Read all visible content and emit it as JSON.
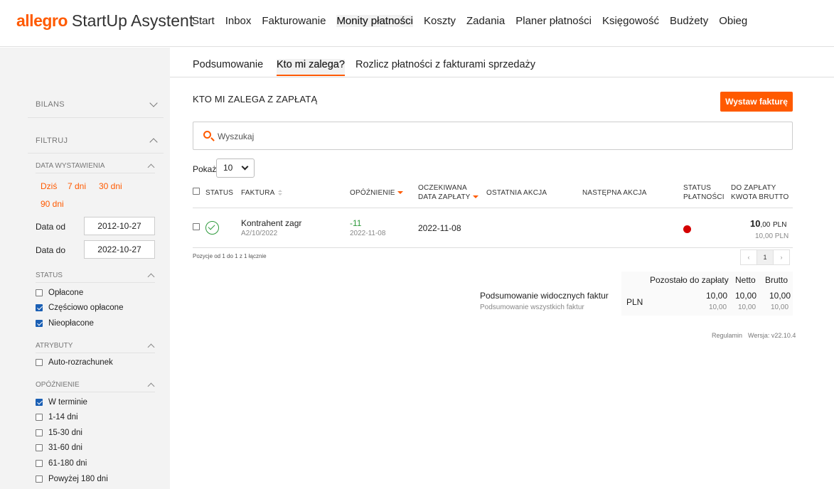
{
  "header": {
    "brand": "allegro",
    "app_name": "StartUp Asystent",
    "nav": [
      "Start",
      "Inbox",
      "Fakturowanie",
      "Monity płatności",
      "Koszty",
      "Zadania",
      "Planer płatności",
      "Księgowość",
      "Budżety",
      "Obieg"
    ],
    "active_nav": "Monity płatności"
  },
  "sidebar": {
    "bilans": "BILANS",
    "filtruj": "FILTRUJ",
    "date_section": "DATA WYSTAWIENIA",
    "quick_ranges": [
      "Dziś",
      "7 dni",
      "30 dni",
      "90 dni"
    ],
    "date_from_label": "Data od",
    "date_from": "2012-10-27",
    "date_to_label": "Data do",
    "date_to": "2022-10-27",
    "status_section": "STATUS",
    "status_items": [
      {
        "label": "Opłacone",
        "checked": false
      },
      {
        "label": "Częściowo opłacone",
        "checked": true
      },
      {
        "label": "Nieopłacone",
        "checked": true
      }
    ],
    "attr_section": "ATRYBUTY",
    "attr_items": [
      {
        "label": "Auto-rozrachunek",
        "checked": false
      }
    ],
    "delay_section": "OPÓŹNIENIE",
    "delay_items": [
      {
        "label": "W terminie",
        "checked": true
      },
      {
        "label": "1-14 dni",
        "checked": false
      },
      {
        "label": "15-30 dni",
        "checked": false
      },
      {
        "label": "31-60 dni",
        "checked": false
      },
      {
        "label": "61-180 dni",
        "checked": false
      },
      {
        "label": "Powyżej 180 dni",
        "checked": false
      }
    ]
  },
  "tabs": [
    "Podsumowanie",
    "Kto mi zalega?",
    "Rozlicz płatności z fakturami sprzedaży"
  ],
  "main": {
    "title": "KTO MI ZALEGA Z ZAPŁATĄ",
    "new_invoice_button": "Wystaw fakturę",
    "search_placeholder": "Wyszukaj",
    "show_label": "Pokaż",
    "show_value": "10",
    "columns": {
      "status": "STATUS",
      "faktura": "FAKTURA",
      "opoznienie": "OPÓŹNIENIE",
      "expected_1": "OCZEKIWANA",
      "expected_2": "DATA ZAPŁATY",
      "last_action": "OSTATNIA AKCJA",
      "next_action": "NASTĘPNA AKCJA",
      "pay_status_1": "STATUS",
      "pay_status_2": "PŁATNOŚCI",
      "to_pay_1": "DO ZAPŁATY",
      "to_pay_2": "KWOTA BRUTTO"
    },
    "rows": [
      {
        "contractor": "Kontrahent zagr",
        "invoice_no": "A2/10/2022",
        "delay": "-11",
        "delay_date": "2022-11-08",
        "expected_date": "2022-11-08",
        "amount_int": "10",
        "amount_dec": ",00",
        "currency": "PLN",
        "gross": "10,00 PLN",
        "status_color": "#d40000"
      }
    ],
    "pagination_info": "Pozycje od 1 do 1 z 1 łącznie",
    "pagination": {
      "prev": "‹",
      "current": "1",
      "next": "›"
    }
  },
  "summary": {
    "col_remaining": "Pozostało do zapłaty",
    "col_net": "Netto",
    "col_gross": "Brutto",
    "visible_label": "Podsumowanie widocznych faktur",
    "all_label": "Podsumowanie wszystkich faktur",
    "currency": "PLN",
    "visible": {
      "remaining": "10,00",
      "net": "10,00",
      "gross": "10,00"
    },
    "all": {
      "remaining": "10,00",
      "net": "10,00",
      "gross": "10,00"
    }
  },
  "footer": {
    "terms": "Regulamin",
    "version": "Wersja: v22.10.4"
  }
}
